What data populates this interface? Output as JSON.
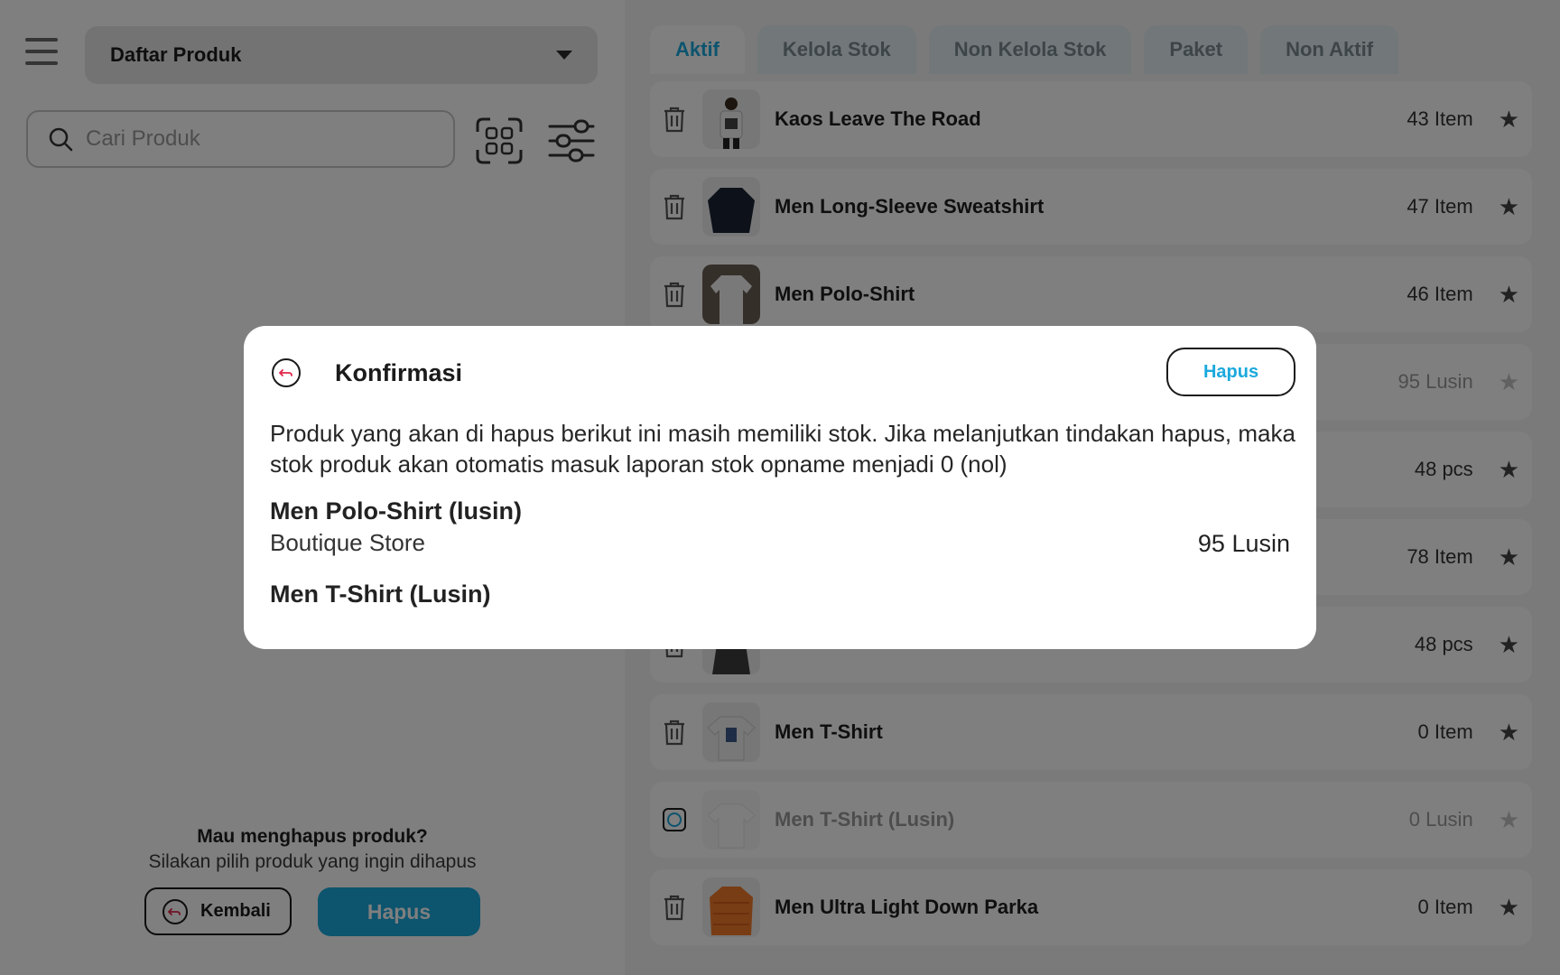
{
  "header": {
    "page_select_label": "Daftar Produk"
  },
  "search": {
    "placeholder": "Cari Produk"
  },
  "tabs": [
    {
      "label": "Aktif",
      "active": true
    },
    {
      "label": "Kelola Stok",
      "active": false
    },
    {
      "label": "Non Kelola Stok",
      "active": false
    },
    {
      "label": "Paket",
      "active": false
    },
    {
      "label": "Non Aktif",
      "active": false
    }
  ],
  "products": [
    {
      "name": "Kaos Leave The Road",
      "qty": "43 Item"
    },
    {
      "name": "Men Long-Sleeve Sweatshirt",
      "qty": "47 Item"
    },
    {
      "name": "Men Polo-Shirt",
      "qty": "46 Item"
    },
    {
      "name": "",
      "qty": "95 Lusin"
    },
    {
      "name": "",
      "qty": "48 pcs"
    },
    {
      "name": "",
      "qty": "78 Item"
    },
    {
      "name": "",
      "qty": "48 pcs"
    },
    {
      "name": "Men T-Shirt",
      "qty": "0 Item"
    },
    {
      "name": "Men T-Shirt (Lusin)",
      "qty": "0 Lusin"
    },
    {
      "name": "Men Ultra Light Down Parka",
      "qty": "0 Item"
    }
  ],
  "delete_prompt": {
    "question": "Mau menghapus produk?",
    "subtitle": "Silakan pilih produk yang ingin dihapus",
    "back_label": "Kembali",
    "delete_label": "Hapus"
  },
  "modal": {
    "title": "Konfirmasi",
    "delete_label": "Hapus",
    "message": "Produk yang akan di hapus berikut ini masih memiliki stok. Jika melanjutkan tindakan hapus, maka stok produk akan otomatis masuk laporan stok opname menjadi 0 (nol)",
    "items": [
      {
        "name": "Men Polo-Shirt (lusin)",
        "store": "Boutique Store",
        "qty": "95 Lusin"
      },
      {
        "name": "Men T-Shirt (Lusin)"
      }
    ]
  },
  "colors": {
    "accent": "#1aa9dd",
    "overlay": "rgba(0,0,0,0.5)",
    "undo_icon": "#e0264a"
  }
}
